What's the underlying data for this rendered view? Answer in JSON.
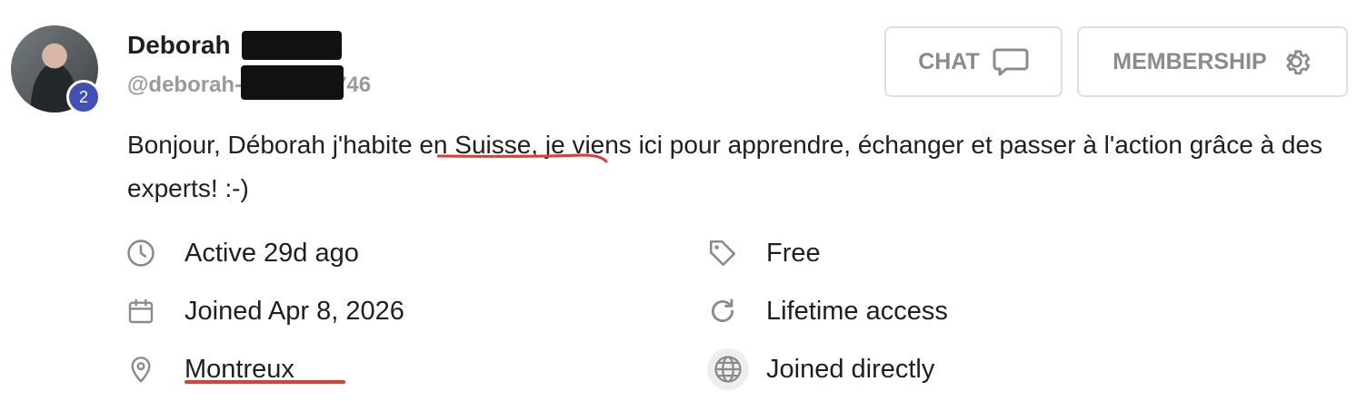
{
  "profile": {
    "name": "Deborah",
    "handle_prefix": "@deborah-",
    "handle_suffix": "746",
    "level": "2",
    "bio": "Bonjour, Déborah j'habite en Suisse, je viens ici pour apprendre, échanger et passer à l'action grâce à des experts! :-)"
  },
  "actions": {
    "chat_label": "CHAT",
    "membership_label": "MEMBERSHIP"
  },
  "meta_left": [
    {
      "icon": "clock-icon",
      "text": "Active 29d ago"
    },
    {
      "icon": "calendar-icon",
      "text": "Joined Apr 8, 2026"
    },
    {
      "icon": "location-pin-icon",
      "text": "Montreux"
    }
  ],
  "meta_right": [
    {
      "icon": "tag-icon",
      "text": "Free"
    },
    {
      "icon": "refresh-icon",
      "text": "Lifetime access"
    },
    {
      "icon": "globe-icon",
      "text": "Joined directly"
    }
  ],
  "colors": {
    "badge": "#3f51b5",
    "annotation": "#e53935",
    "muted": "#8b8b8b"
  }
}
